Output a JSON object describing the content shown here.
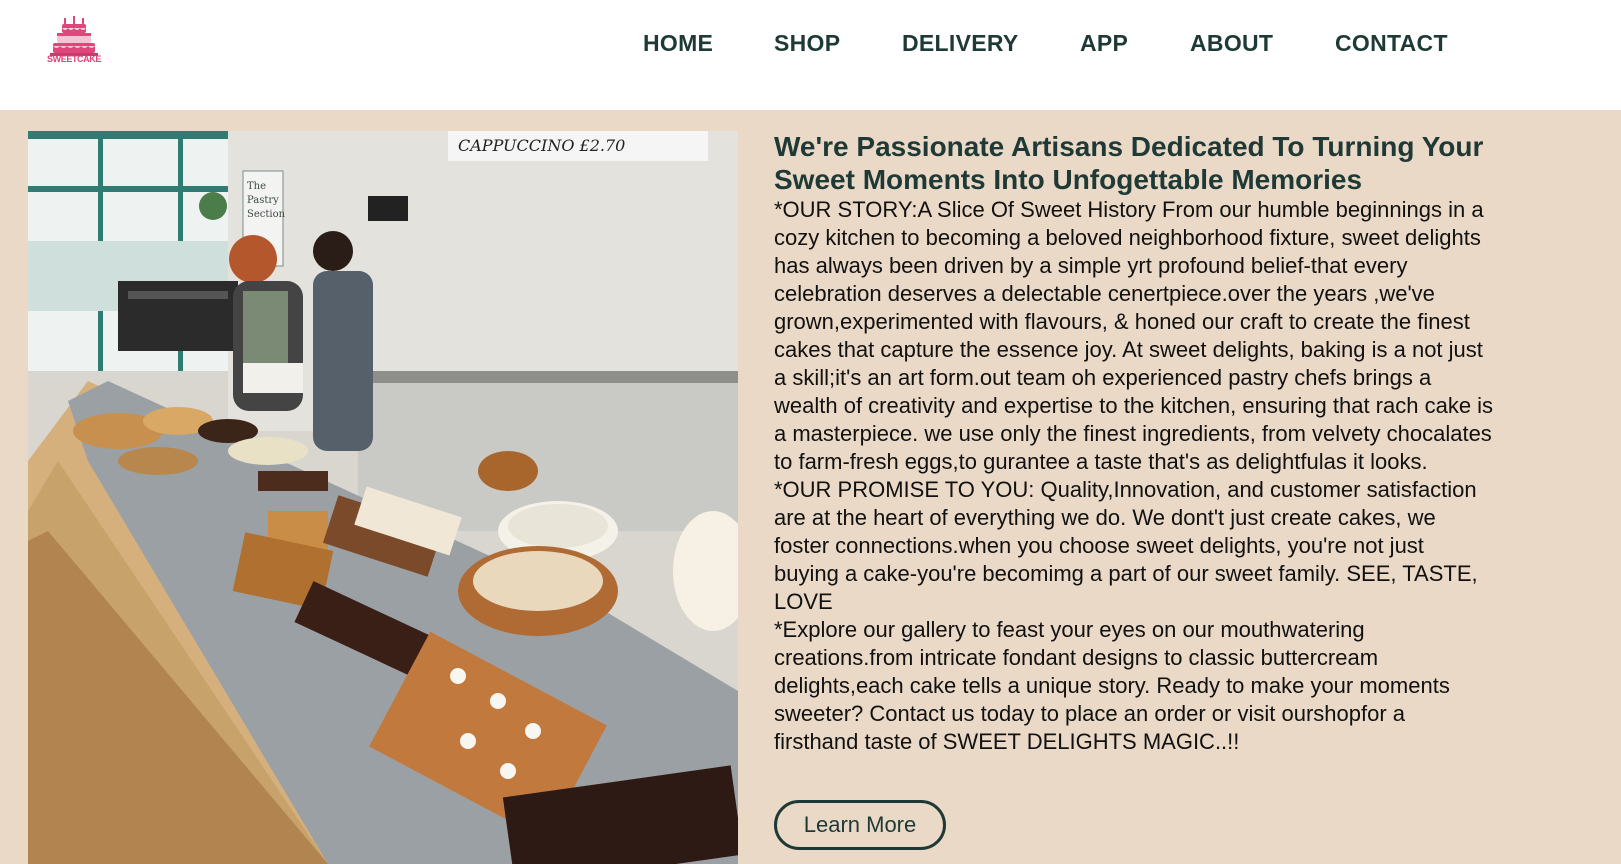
{
  "brand": {
    "logo_text": "SWEETCAKE",
    "colors": {
      "primary": "#1f3a36",
      "background": "#ead9c6",
      "accent": "#e0457b"
    }
  },
  "nav": {
    "items": [
      "HOME",
      "SHOP",
      "DELIVERY",
      "APP",
      "ABOUT",
      "CONTACT"
    ]
  },
  "hero_image": {
    "sign_text": "CAPPUCCINO  £2.70",
    "poster_text": "The Pastry Section"
  },
  "about": {
    "headline": "We're Passionate Artisans Dedicated To Turning Your Sweet Moments Into Unfogettable Memories",
    "paragraphs": [
      "*OUR STORY:A Slice Of Sweet History From our humble beginnings in a cozy kitchen to becoming a beloved neighborhood fixture, sweet delights has always been driven by a simple yrt profound belief-that every celebration deserves a delectable cenertpiece.over the years ,we've grown,experimented with flavours, & honed our craft to create the finest cakes that capture the essence joy. At sweet delights, baking is a not just a skill;it's an art form.out team oh experienced pastry chefs brings a wealth of creativity and expertise to the kitchen, ensuring that rach cake is a masterpiece. we use only the finest ingredients, from velvety chocalates to farm-fresh eggs,to gurantee a taste that's as delightfulas it looks.",
      "*OUR PROMISE TO YOU: Quality,Innovation, and customer satisfaction are at the heart of everything we do. We dont't just create cakes, we foster connections.when you choose sweet delights, you're not just buying a cake-you're becomimg a part of our sweet family. SEE, TASTE, LOVE",
      "*Explore our gallery to feast your eyes on our mouthwatering creations.from intricate fondant designs to classic buttercream delights,each cake tells a unique story. Ready to make your moments sweeter? Contact us today to place an order or visit ourshopfor a firsthand taste of SWEET DELIGHTS MAGIC..!!"
    ],
    "button_label": "Learn More"
  }
}
